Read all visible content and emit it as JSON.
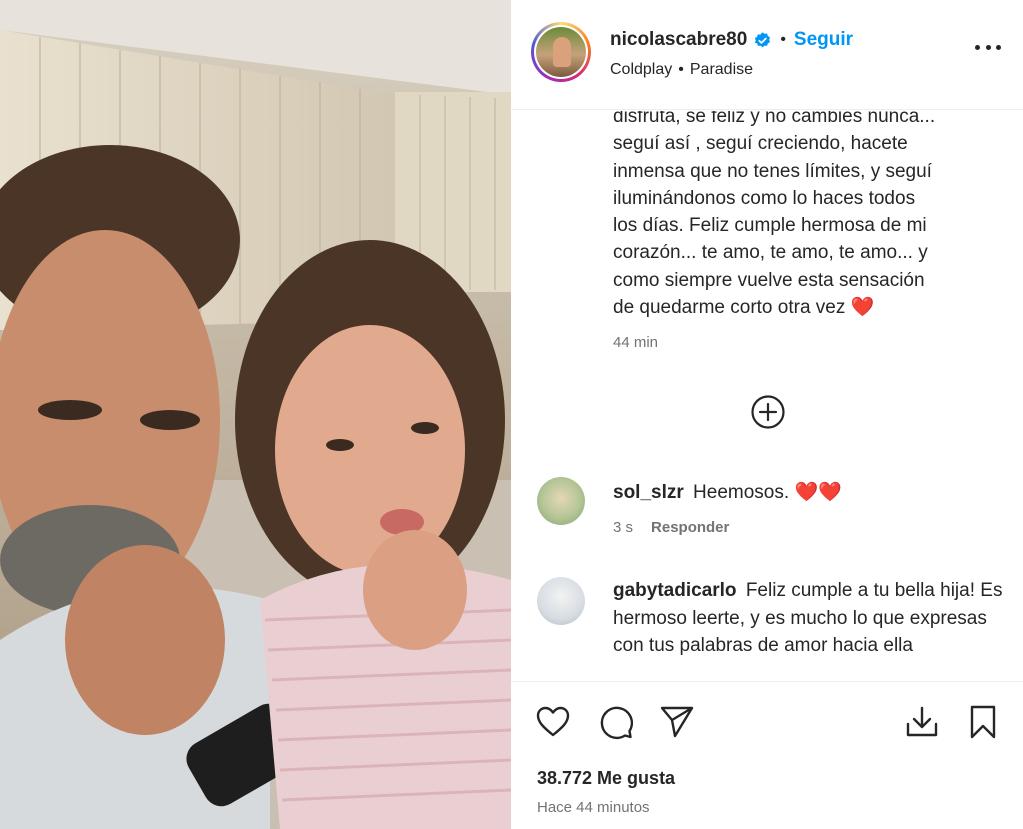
{
  "post": {
    "username": "nicolascabre80",
    "follow_label": "Seguir",
    "separator": "•",
    "music": {
      "artist": "Coldplay",
      "song": "Paradise"
    },
    "caption_lines": [
      "disfruta, se feliz y no cambies nunca...",
      "seguí así , seguí creciendo, hacete",
      "inmensa que no tenes límites, y seguí",
      "iluminándonos como lo haces todos",
      "los días. Feliz cumple hermosa de mi",
      "corazón... te amo, te amo, te amo... y",
      "como siempre vuelve esta sensación",
      "de quedarme corto otra vez"
    ],
    "caption_end_emoji": "❤️",
    "caption_time": "44 min"
  },
  "comments": [
    {
      "user": "sol_slzr",
      "text": "Heemosos.",
      "emoji": "❤️❤️",
      "time": "3 s",
      "reply_label": "Responder"
    },
    {
      "user": "gabytadicarlo",
      "text": "Feliz cumple a tu bella hija! Es hermoso leerte, y es mucho lo que expresas con tus palabras de amor hacia ella"
    }
  ],
  "footer": {
    "likes": "38.772 Me gusta",
    "posted": "Hace 44 minutos"
  },
  "icons": {
    "like": "heart-outline-icon",
    "comment": "speech-bubble-icon",
    "share": "paper-plane-icon",
    "download": "download-icon",
    "save": "bookmark-icon",
    "more": "ellipsis-icon",
    "verified": "verified-badge-icon",
    "load_more": "plus-circle-icon"
  },
  "colors": {
    "link_blue": "#0095f6",
    "verified_blue": "#0095f6",
    "heart_red": "#e0245e",
    "muted": "#737373"
  }
}
